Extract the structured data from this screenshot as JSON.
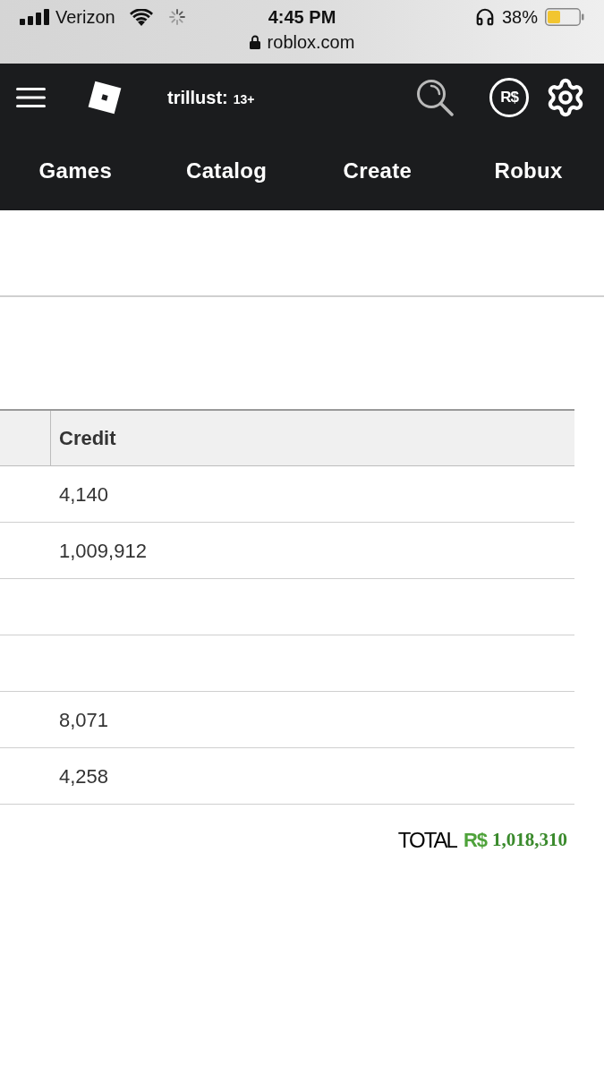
{
  "status_bar": {
    "carrier": "Verizon",
    "time": "4:45 PM",
    "battery": "38%",
    "url": "roblox.com"
  },
  "header": {
    "username": "trillust:",
    "age_badge": "13+",
    "currency_symbol": "R$"
  },
  "nav": [
    {
      "label": "Games"
    },
    {
      "label": "Catalog"
    },
    {
      "label": "Create"
    },
    {
      "label": "Robux"
    }
  ],
  "table": {
    "credit_heading": "Credit",
    "rows": [
      {
        "credit": "4,140"
      },
      {
        "credit": "1,009,912"
      },
      {},
      {},
      {
        "credit": "8,071"
      },
      {
        "credit": "4,258"
      }
    ]
  },
  "total": {
    "label": "TOTAL",
    "currency_symbol": "R$",
    "amount": "1,018,310"
  }
}
